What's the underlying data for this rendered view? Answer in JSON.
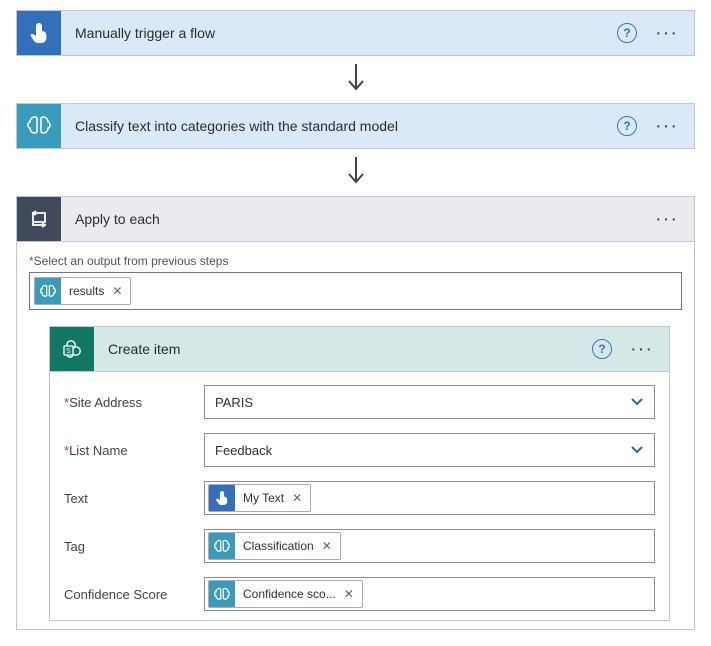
{
  "step1": {
    "title": "Manually trigger a flow"
  },
  "step2": {
    "title": "Classify text into categories with the standard model"
  },
  "apply": {
    "title": "Apply to each",
    "select_label_prefix": "*",
    "select_label": "Select an output from previous steps",
    "chip": "results"
  },
  "create": {
    "title": "Create item",
    "fields": {
      "site": {
        "label": "Site Address",
        "required": true,
        "value": "PARIS"
      },
      "list": {
        "label": "List Name",
        "required": true,
        "value": "Feedback"
      },
      "text": {
        "label": "Text",
        "chip": "My Text"
      },
      "tag": {
        "label": "Tag",
        "chip": "Classification"
      },
      "conf": {
        "label": "Confidence Score",
        "chip": "Confidence sco..."
      }
    }
  }
}
